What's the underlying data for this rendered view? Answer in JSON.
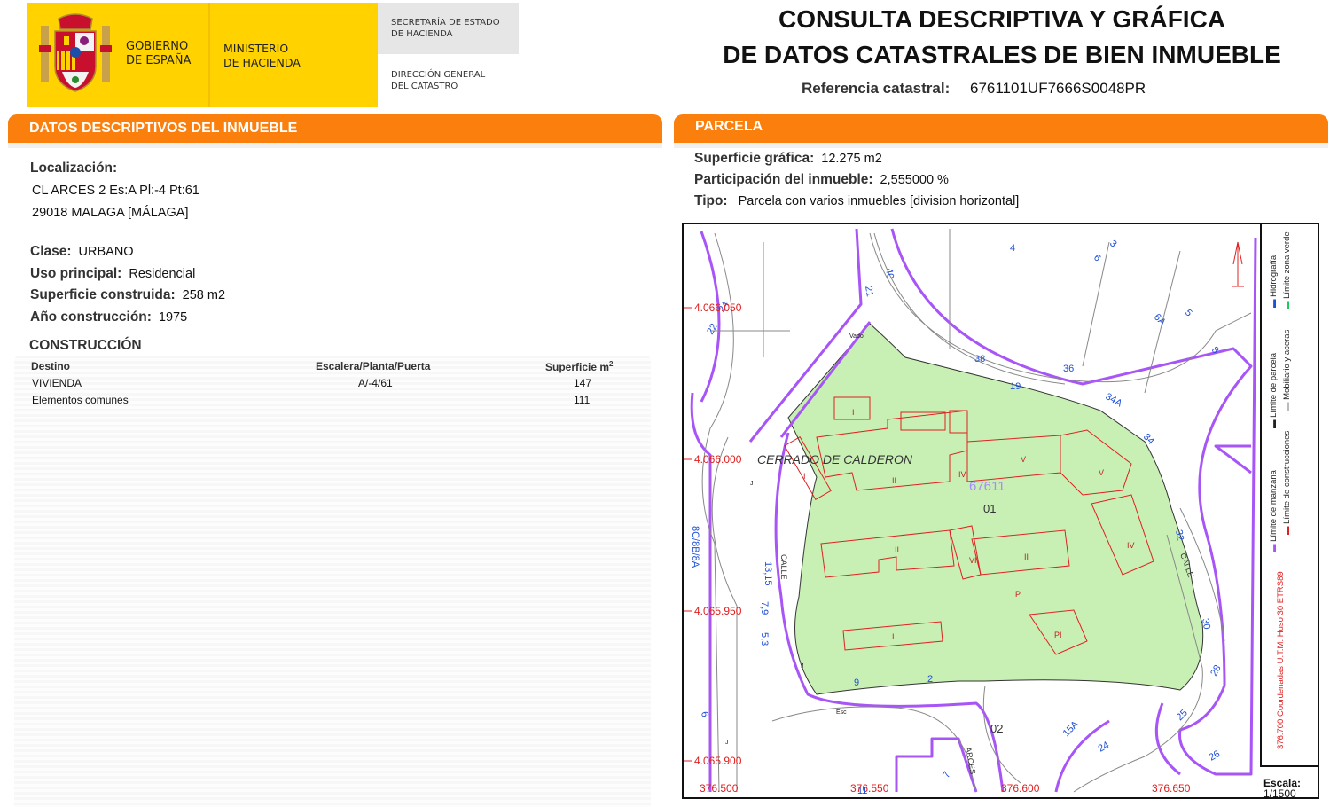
{
  "header": {
    "gobierno": [
      "GOBIERNO",
      "DE ESPAÑA"
    ],
    "ministerio": [
      "MINISTERIO",
      "DE HACIENDA"
    ],
    "secretaria": [
      "SECRETARÍA DE ESTADO",
      "DE HACIENDA"
    ],
    "direccion": [
      "DIRECCIÓN GENERAL",
      "DEL CATASTRO"
    ]
  },
  "title": [
    "CONSULTA DESCRIPTIVA Y GRÁFICA",
    "DE DATOS CATASTRALES DE BIEN INMUEBLE"
  ],
  "referencia": {
    "label": "Referencia catastral:",
    "value": "6761101UF7666S0048PR"
  },
  "left": {
    "section": "DATOS DESCRIPTIVOS DEL INMUEBLE",
    "localizacion_label": "Localización:",
    "direccion": [
      "CL ARCES 2 Es:A Pl:-4 Pt:61",
      "29018 MALAGA [MÁLAGA]"
    ],
    "clase": {
      "label": "Clase:",
      "value": "URBANO"
    },
    "uso": {
      "label": "Uso principal:",
      "value": "Residencial"
    },
    "superficie": {
      "label": "Superficie construida:",
      "value": "258 m2"
    },
    "anio": {
      "label": "Año construcción:",
      "value": "1975"
    },
    "construccion_title": "CONSTRUCCIÓN",
    "table": {
      "headers": [
        "Destino",
        "Escalera/Planta/Puerta",
        "Superficie m",
        "2"
      ],
      "rows": [
        [
          "VIVIENDA",
          "A/-4/61",
          "147"
        ],
        [
          "Elementos comunes",
          "",
          "111"
        ]
      ]
    }
  },
  "right": {
    "section": "PARCELA",
    "superficie_grafica": {
      "label": "Superficie gráfica:",
      "value": "12.275 m2"
    },
    "participacion": {
      "label": "Participación del inmueble:",
      "value": "2,555000 %"
    },
    "tipo": {
      "label": "Tipo:",
      "value": "Parcela con varios inmuebles [division horizontal]"
    },
    "map": {
      "street_name": "CERRADO DE CALDERON",
      "parcel_ref": "67611",
      "parcel_num": "01",
      "parcel_num2": "02",
      "coords_y": [
        "4.066.050",
        "4.066.000",
        "4.065.950",
        "4.065.900"
      ],
      "coords_x": [
        "376.500",
        "376.550",
        "376.600",
        "376.650"
      ],
      "street_labels": [
        "CALLE",
        "CALLE",
        "ARCES"
      ],
      "building_labels": [
        "I",
        "II",
        "IV",
        "V",
        "V",
        "IV",
        "VI",
        "II",
        "II",
        "I",
        "P",
        "PI",
        "I"
      ],
      "numbers": [
        "40",
        "21",
        "24",
        "22",
        "4",
        "6",
        "3",
        "6A",
        "5",
        "8",
        "38",
        "36",
        "19",
        "34A",
        "34",
        "32",
        "30",
        "28",
        "25",
        "26",
        "24",
        "15A",
        "2",
        "7",
        "9",
        "6",
        "5,3",
        "7,9",
        "13,15",
        "8C/8B/8A",
        "11"
      ],
      "small_labels": [
        "Vado",
        "Esc",
        "J",
        "J",
        "J"
      ]
    },
    "legend": {
      "limite_manzana": "Límite de manzana",
      "limite_parcela": "Límite de parcela",
      "hidrografia": "Hidrografía",
      "limite_construcciones": "Límite de construcciones",
      "mobiliario": "Mobiliario y aceras",
      "zona_verde": "Límite zona verde",
      "coordenadas": "376.700 Coordenadas U.T.M. Huso 30 ETRS89",
      "escala_label": "Escala:",
      "escala_value": "1/1500"
    },
    "colors": {
      "green": "#c8f0b4",
      "purple": "#a855f7",
      "red": "#e02020",
      "blue": "#1d4fd8",
      "orange": "#fb7f0d"
    }
  }
}
